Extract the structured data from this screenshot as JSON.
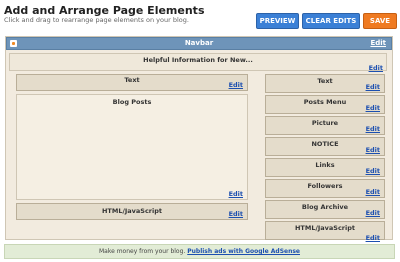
{
  "header": {
    "title": "Add and Arrange Page Elements",
    "subtitle": "Click and drag to rearrange page elements on your blog."
  },
  "toolbar": {
    "preview_label": "PREVIEW",
    "clear_label": "CLEAR EDITS",
    "save_label": "SAVE"
  },
  "navbar": {
    "label": "Navbar",
    "edit": "Edit"
  },
  "header_gadget": {
    "label": "Helpful Information for New...",
    "edit": "Edit"
  },
  "main": {
    "top_gadget": {
      "label": "Text",
      "edit": "Edit"
    },
    "posts": {
      "label": "Blog Posts",
      "edit": "Edit"
    },
    "bottom_gadget": {
      "label": "HTML/JavaScript",
      "edit": "Edit"
    }
  },
  "sidebar": {
    "items": [
      {
        "label": "Text",
        "edit": "Edit"
      },
      {
        "label": "Posts Menu",
        "edit": "Edit"
      },
      {
        "label": "Picture",
        "edit": "Edit"
      },
      {
        "label": "NOTICE",
        "edit": "Edit"
      },
      {
        "label": "Links",
        "edit": "Edit"
      },
      {
        "label": "Followers",
        "edit": "Edit"
      },
      {
        "label": "Blog Archive",
        "edit": "Edit"
      },
      {
        "label": "HTML/JavaScript",
        "edit": "Edit"
      }
    ]
  },
  "ad_bar": {
    "text": "Make money from your blog.",
    "link": "Publish ads with Google AdSense"
  }
}
